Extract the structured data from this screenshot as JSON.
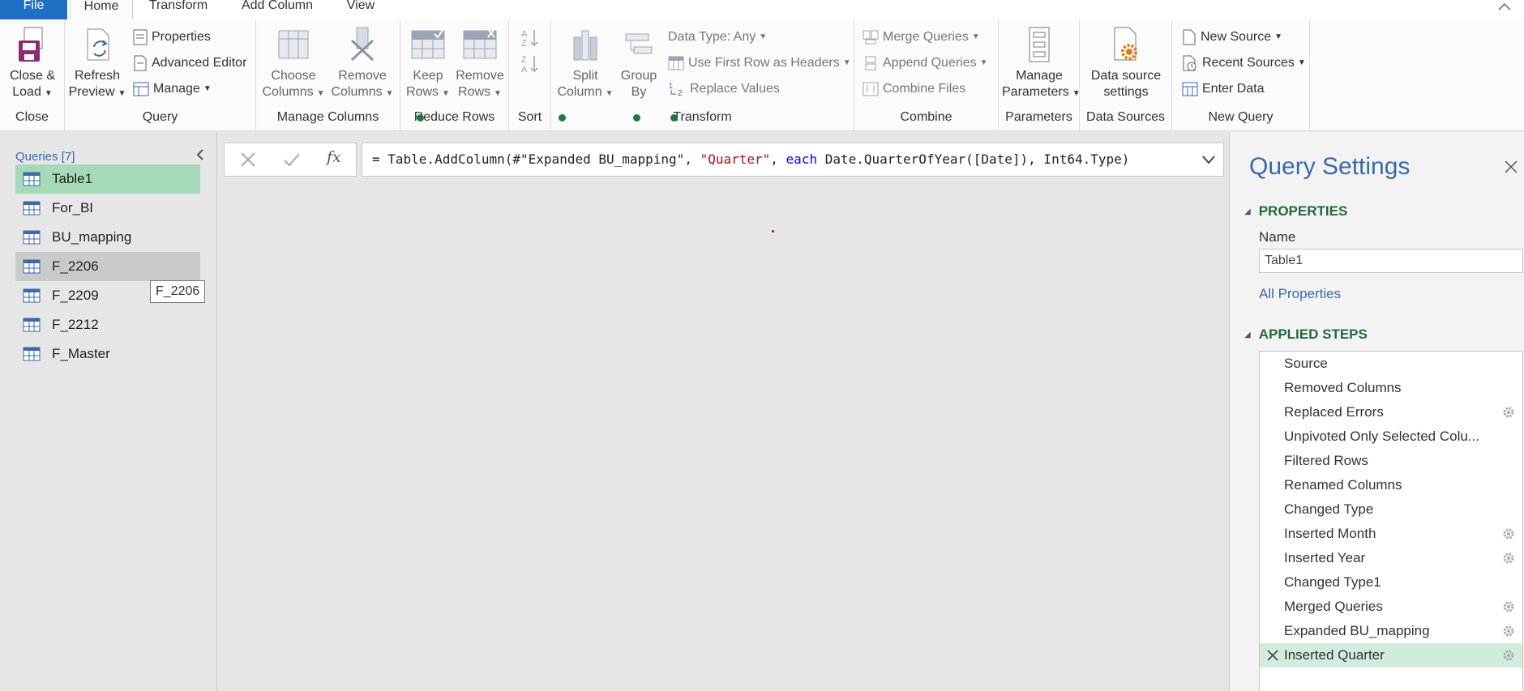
{
  "tabs": {
    "file": "File",
    "home": "Home",
    "transform": "Transform",
    "add_column": "Add Column",
    "view": "View"
  },
  "ribbon": {
    "close_group": {
      "label": "Close",
      "close_load": [
        "Close &",
        "Load"
      ]
    },
    "query_group": {
      "label": "Query",
      "refresh_preview": [
        "Refresh",
        "Preview"
      ],
      "properties": "Properties",
      "advanced_editor": "Advanced Editor",
      "manage": "Manage"
    },
    "manage_columns_group": {
      "label": "Manage Columns",
      "choose_columns": [
        "Choose",
        "Columns"
      ],
      "remove_columns": [
        "Remove",
        "Columns"
      ]
    },
    "reduce_rows_group": {
      "label": "Reduce Rows",
      "keep_rows": [
        "Keep",
        "Rows"
      ],
      "remove_rows": [
        "Remove",
        "Rows"
      ]
    },
    "sort_group": {
      "label": "Sort"
    },
    "transform_group": {
      "label": "Transform",
      "split_column": [
        "Split",
        "Column"
      ],
      "group_by": [
        "Group",
        "By"
      ],
      "data_type": "Data Type: Any",
      "use_first_row": "Use First Row as Headers",
      "replace_values": "Replace Values"
    },
    "combine_group": {
      "label": "Combine",
      "merge_queries": "Merge Queries",
      "append_queries": "Append Queries",
      "combine_files": "Combine Files"
    },
    "parameters_group": {
      "label": "Parameters",
      "manage_parameters": [
        "Manage",
        "Parameters"
      ]
    },
    "data_sources_group": {
      "label": "Data Sources",
      "data_source_settings": [
        "Data source",
        "settings"
      ]
    },
    "new_query_group": {
      "label": "New Query",
      "new_source": "New Source",
      "recent_sources": "Recent Sources",
      "enter_data": "Enter Data"
    }
  },
  "queries": {
    "title": "Queries [7]",
    "items": [
      "Table1",
      "For_BI",
      "BU_mapping",
      "F_2206",
      "F_2209",
      "F_2212",
      "F_Master"
    ],
    "tooltip": "F_2206"
  },
  "formula": {
    "prefix": "= Table.AddColumn(#\"Expanded BU_mapping\", ",
    "string": "\"Quarter\"",
    "sep": ", ",
    "keyword": "each",
    "rest": " Date.QuarterOfYear([Date]), Int64.Type)",
    "fx": "fx"
  },
  "settings": {
    "title": "Query Settings",
    "properties_heading": "PROPERTIES",
    "name_label": "Name",
    "name_value": "Table1",
    "all_properties": "All Properties",
    "applied_steps_heading": "APPLIED STEPS",
    "steps": [
      {
        "label": "Source",
        "gear": false
      },
      {
        "label": "Removed Columns",
        "gear": false
      },
      {
        "label": "Replaced Errors",
        "gear": true
      },
      {
        "label": "Unpivoted Only Selected Colu...",
        "gear": false
      },
      {
        "label": "Filtered Rows",
        "gear": false
      },
      {
        "label": "Renamed Columns",
        "gear": false
      },
      {
        "label": "Changed Type",
        "gear": false
      },
      {
        "label": "Inserted Month",
        "gear": true
      },
      {
        "label": "Inserted Year",
        "gear": true
      },
      {
        "label": "Changed Type1",
        "gear": false
      },
      {
        "label": "Merged Queries",
        "gear": true
      },
      {
        "label": "Expanded BU_mapping",
        "gear": true
      },
      {
        "label": "Inserted Quarter",
        "gear": true
      }
    ]
  },
  "colors": {
    "file_tab": "#1e6fc6",
    "selected_query": "#a5d9b8",
    "section_heading": "#1f6b3c",
    "link": "#3a6aa8",
    "selected_step": "#d1ecdc",
    "string": "#a31515",
    "keyword": "#0000ff"
  }
}
